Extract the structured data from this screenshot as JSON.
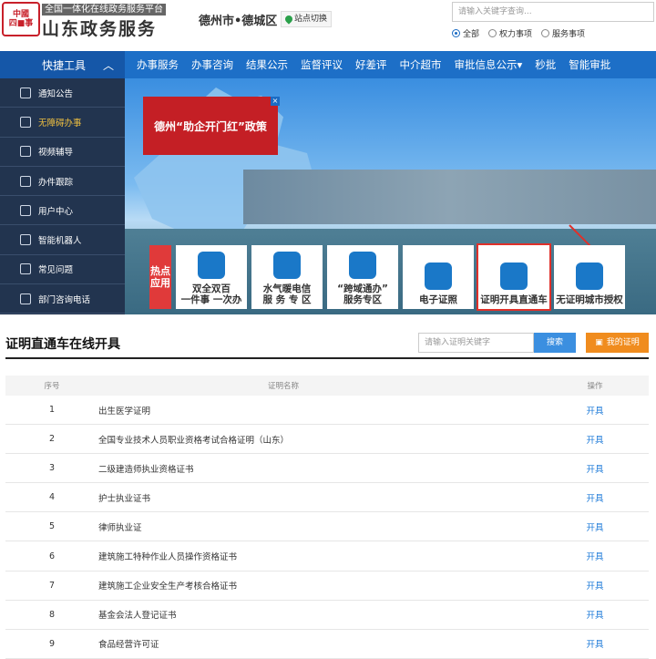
{
  "header": {
    "logo_text": "中國\n四■事",
    "platform_subtitle": "全国一体化在线政务服务平台",
    "platform_title": "山东政务服务",
    "city": "德州市•德城区",
    "site_switch": "站点切换",
    "search_placeholder": "请输入关键字查询...",
    "search_scope": [
      {
        "label": "全部",
        "selected": true
      },
      {
        "label": "权力事项",
        "selected": false
      },
      {
        "label": "服务事项",
        "selected": false
      }
    ]
  },
  "nav": {
    "quick_tools": "快捷工具",
    "items": [
      "办事服务",
      "办事咨询",
      "结果公示",
      "监督评议",
      "好差评",
      "中介超市",
      "审批信息公示▾",
      "秒批",
      "智能审批"
    ]
  },
  "sidebar": {
    "items": [
      {
        "label": "通知公告",
        "icon": "notice-icon"
      },
      {
        "label": "无障碍办事",
        "icon": "accessibility-icon"
      },
      {
        "label": "视频辅导",
        "icon": "video-icon"
      },
      {
        "label": "办件跟踪",
        "icon": "track-icon"
      },
      {
        "label": "用户中心",
        "icon": "user-icon"
      },
      {
        "label": "智能机器人",
        "icon": "robot-icon"
      },
      {
        "label": "常见问题",
        "icon": "question-icon"
      },
      {
        "label": "部门咨询电话",
        "icon": "phone-icon"
      }
    ]
  },
  "banner": {
    "policy_text": "德州“助企开门红”政策",
    "hot_label": "热点应用",
    "apps": [
      {
        "label": "双全双百\n一件事 一次办"
      },
      {
        "label": "水气暖电信\n服 务 专 区"
      },
      {
        "label": "“跨域通办”\n服务专区"
      },
      {
        "label": "电子证照"
      },
      {
        "label": "证明开具直通车"
      },
      {
        "label": "无证明城市授权"
      }
    ]
  },
  "certificate": {
    "title": "证明直通车在线开具",
    "search_placeholder": "请输入证明关键字",
    "search_button": "搜索",
    "my_button": "我的证明",
    "columns": [
      "序号",
      "证明名称",
      "操作"
    ],
    "rows": [
      {
        "no": "1",
        "name": "出生医学证明",
        "op": "开具"
      },
      {
        "no": "2",
        "name": "全国专业技术人员职业资格考试合格证明（山东）",
        "op": "开具"
      },
      {
        "no": "3",
        "name": "二级建造师执业资格证书",
        "op": "开具"
      },
      {
        "no": "4",
        "name": "护士执业证书",
        "op": "开具"
      },
      {
        "no": "5",
        "name": "律师执业证",
        "op": "开具"
      },
      {
        "no": "6",
        "name": "建筑施工特种作业人员操作资格证书",
        "op": "开具"
      },
      {
        "no": "7",
        "name": "建筑施工企业安全生产考核合格证书",
        "op": "开具"
      },
      {
        "no": "8",
        "name": "基金会法人登记证书",
        "op": "开具"
      },
      {
        "no": "9",
        "name": "食品经营许可证",
        "op": "开具"
      }
    ]
  },
  "colors": {
    "nav_blue": "#1d6fc7",
    "sidebar": "#22344f",
    "accent_red": "#c41f25",
    "orange": "#f08c1e",
    "link": "#1a78d8"
  }
}
